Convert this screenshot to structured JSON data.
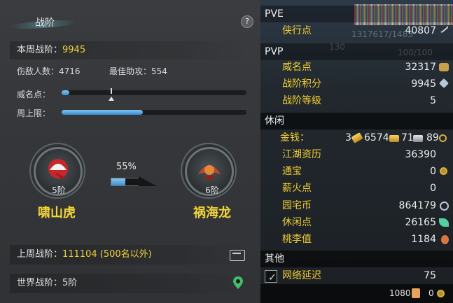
{
  "left": {
    "title": "战阶",
    "help_glyph": "?",
    "week_rank_label": "本周战阶：",
    "week_rank_value": "9945",
    "kills_label": "伤敌人数：",
    "kills_value": "4716",
    "assist_label": "最佳助攻：",
    "assist_value": "554",
    "fame_label": "威名点：",
    "fame_progress": 0.04,
    "fame_marker": 0.27,
    "weekly_cap_label": "周上限：",
    "weekly_cap_progress": 0.44,
    "current_rank": {
      "level": "5阶",
      "name": "啸山虎",
      "icon": "red-fan-emblem-icon"
    },
    "next_rank": {
      "level": "6阶",
      "name": "祸海龙",
      "icon": "red-dragon-emblem-icon"
    },
    "rank_progress_pct": "55%",
    "rank_progress": 0.55,
    "last_week_label": "上周战阶：",
    "last_week_value": "111104 (500名以外)",
    "world_rank_label": "世界战阶：",
    "world_rank_value": "5阶"
  },
  "right": {
    "pve_header": "PVE",
    "pve_items": [
      {
        "label": "侠行点",
        "value": "40807",
        "icon": "sword-icon"
      }
    ],
    "ghost_text_1": "1317617/1483",
    "ghost_text_2": "130",
    "ghost_text_3": "100/100",
    "pvp_header": "PVP",
    "pvp_items": [
      {
        "label": "威名点",
        "value": "32317",
        "icon": "fame-icon"
      },
      {
        "label": "战阶积分",
        "value": "9945",
        "icon": "crystal-icon"
      },
      {
        "label": "战阶等级",
        "value": "5",
        "icon": ""
      }
    ],
    "leisure_header": "休闲",
    "money": {
      "label": "金钱：",
      "gold_bars": "3",
      "ingots": "6574",
      "silver": "71",
      "copper": "89"
    },
    "leisure_items": [
      {
        "label": "江湖资历",
        "value": "36390",
        "icon": ""
      },
      {
        "label": "通宝",
        "value": "0",
        "icon": "coin-icon"
      },
      {
        "label": "薪火点",
        "value": "0",
        "icon": ""
      },
      {
        "label": "园宅币",
        "value": "864179",
        "icon": "swirl-icon"
      },
      {
        "label": "休闲点",
        "value": "26165",
        "icon": "leaf-icon"
      },
      {
        "label": "桃李值",
        "value": "1184",
        "icon": "gourd-icon"
      }
    ],
    "other_header": "其他",
    "network_label": "网络延迟",
    "network_value": "75",
    "footer_value_1": "1080",
    "footer_value_2": "0"
  },
  "colors": {
    "accent_yellow": "#f0d23c",
    "bar_blue": "#3a8fd0",
    "panel_gray": "#35373a",
    "right_bg": "#1c2025"
  }
}
